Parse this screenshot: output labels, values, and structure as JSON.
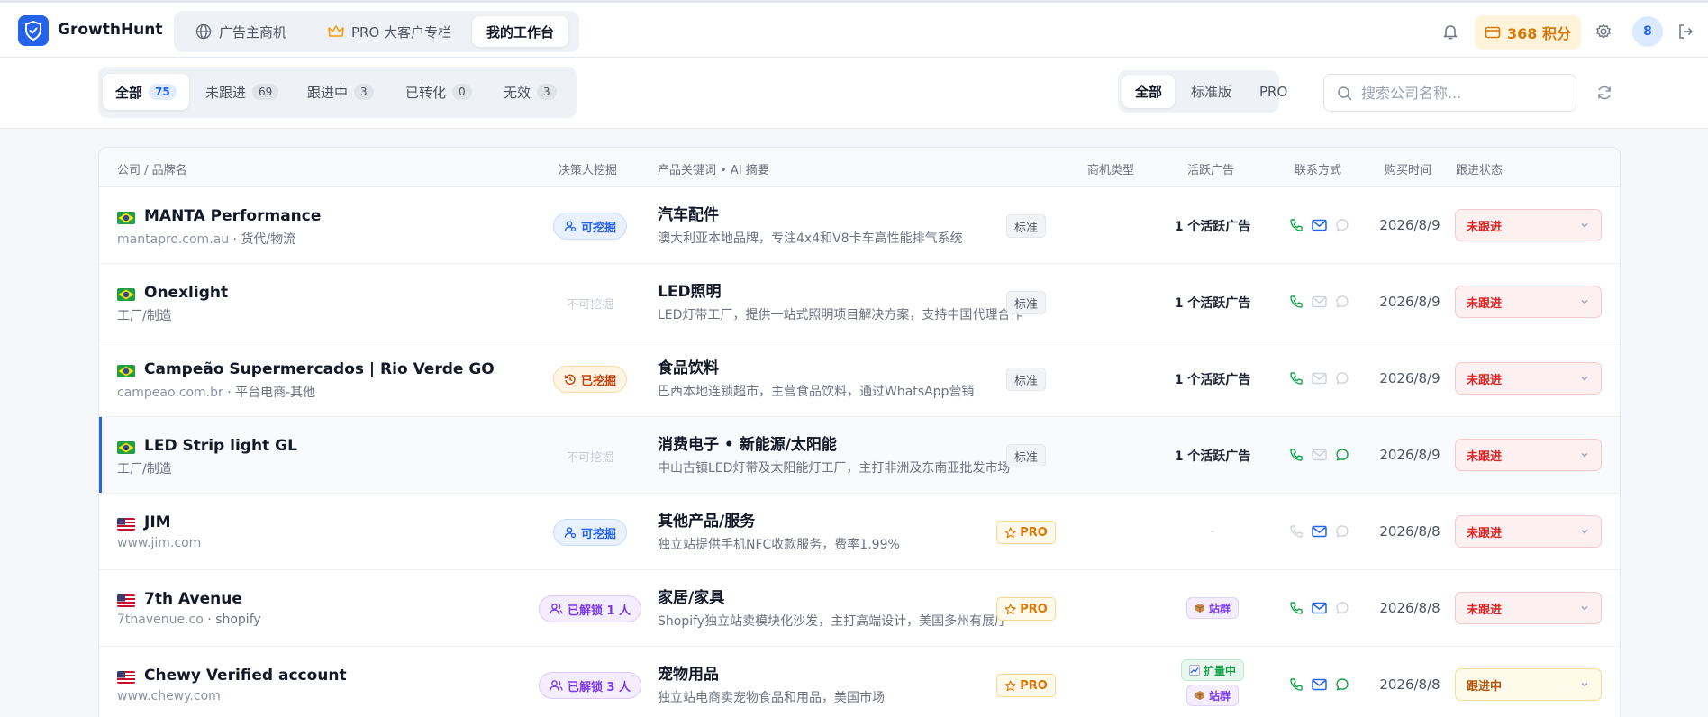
{
  "app": {
    "name": "GrowthHunt",
    "nav": [
      {
        "label": "广告主商机",
        "icon": "globe-icon"
      },
      {
        "label": "PRO 大客户专栏",
        "icon": "crown-icon"
      },
      {
        "label": "我的工作台",
        "icon": ""
      }
    ],
    "active_nav": "我的工作台",
    "points": "368 积分",
    "avatar_initial": "8"
  },
  "filters": {
    "status_tabs": [
      {
        "label": "全部",
        "count": "75"
      },
      {
        "label": "未跟进",
        "count": "69"
      },
      {
        "label": "跟进中",
        "count": "3"
      },
      {
        "label": "已转化",
        "count": "0"
      },
      {
        "label": "无效",
        "count": "3"
      }
    ],
    "active_status": "全部",
    "plan_tabs": [
      "全部",
      "标准版",
      "PRO"
    ],
    "active_plan": "全部",
    "search_placeholder": "搜索公司名称..."
  },
  "table": {
    "headers": {
      "company": "公司 / 品牌名",
      "decision_maker": "决策人挖掘",
      "product": "产品关键词 • AI 摘要",
      "type": "商机类型",
      "ads": "活跃广告",
      "contact": "联系方式",
      "purchase_time": "购买时间",
      "follow": "跟进状态"
    },
    "rows": [
      {
        "flag": "brazil",
        "name": "MANTA Performance",
        "domain": "mantapro.com.au",
        "category": "货代/物流",
        "decision": {
          "kind": "can",
          "label": "可挖掘"
        },
        "keyword": "汽车配件",
        "summary": "澳大利亚本地品牌，专注4x4和V8卡车高性能排气系统",
        "type": {
          "kind": "std",
          "label": "标准"
        },
        "ads": "1 个活跃广告",
        "tags": [],
        "contacts": {
          "phone": true,
          "mail": true,
          "chat": false
        },
        "time": "2026/8/9",
        "follow": {
          "kind": "todo",
          "label": "未跟进"
        },
        "selected": false
      },
      {
        "flag": "brazil",
        "name": "Onexlight",
        "domain": "",
        "category": "工厂/制造",
        "decision": {
          "kind": "no",
          "label": "不可挖掘"
        },
        "keyword": "LED照明",
        "summary": "LED灯带工厂，提供一站式照明项目解决方案，支持中国代理合作",
        "type": {
          "kind": "std",
          "label": "标准"
        },
        "ads": "1 个活跃广告",
        "tags": [],
        "contacts": {
          "phone": true,
          "mail": false,
          "chat": false
        },
        "time": "2026/8/9",
        "follow": {
          "kind": "todo",
          "label": "未跟进"
        },
        "selected": false
      },
      {
        "flag": "brazil",
        "name": "Campeão Supermercados | Rio Verde GO",
        "domain": "campeao.com.br",
        "category": "平台电商-其他",
        "decision": {
          "kind": "done",
          "label": "已挖掘"
        },
        "keyword": "食品饮料",
        "summary": "巴西本地连锁超市，主营食品饮料，通过WhatsApp营销",
        "type": {
          "kind": "std",
          "label": "标准"
        },
        "ads": "1 个活跃广告",
        "tags": [],
        "contacts": {
          "phone": true,
          "mail": false,
          "chat": false
        },
        "time": "2026/8/9",
        "follow": {
          "kind": "todo",
          "label": "未跟进"
        },
        "selected": false
      },
      {
        "flag": "brazil",
        "name": "LED Strip light GL",
        "domain": "",
        "category": "工厂/制造",
        "decision": {
          "kind": "no",
          "label": "不可挖掘"
        },
        "keyword": "消费电子 • 新能源/太阳能",
        "summary": "中山古镇LED灯带及太阳能灯工厂，主打非洲及东南亚批发市场",
        "type": {
          "kind": "std",
          "label": "标准"
        },
        "ads": "1 个活跃广告",
        "tags": [],
        "contacts": {
          "phone": true,
          "mail": false,
          "chat": true
        },
        "time": "2026/8/9",
        "follow": {
          "kind": "todo",
          "label": "未跟进"
        },
        "selected": true
      },
      {
        "flag": "usa",
        "name": "JIM",
        "domain": "www.jim.com",
        "category": "",
        "decision": {
          "kind": "can",
          "label": "可挖掘"
        },
        "keyword": "其他产品/服务",
        "summary": "独立站提供手机NFC收款服务，费率1.99%",
        "type": {
          "kind": "pro",
          "label": "PRO"
        },
        "ads": "-",
        "tags": [],
        "contacts": {
          "phone": false,
          "mail": true,
          "chat": false
        },
        "time": "2026/8/8",
        "follow": {
          "kind": "todo",
          "label": "未跟进"
        },
        "selected": false
      },
      {
        "flag": "usa",
        "name": "7th Avenue",
        "domain": "7thavenue.co",
        "category": "shopify",
        "decision": {
          "kind": "unlock",
          "label": "已解锁 1 人"
        },
        "keyword": "家居/家具",
        "summary": "Shopify独立站卖模块化沙发，主打高端设计，美国多州有展厅",
        "type": {
          "kind": "pro",
          "label": "PRO"
        },
        "ads": "",
        "tags": [
          {
            "kind": "group",
            "label": "站群",
            "icon": "box-icon"
          }
        ],
        "contacts": {
          "phone": true,
          "mail": true,
          "chat": false
        },
        "time": "2026/8/8",
        "follow": {
          "kind": "todo",
          "label": "未跟进"
        },
        "selected": false
      },
      {
        "flag": "usa",
        "name": "Chewy Verified account",
        "domain": "www.chewy.com",
        "category": "",
        "decision": {
          "kind": "unlock",
          "label": "已解锁 3 人"
        },
        "keyword": "宠物用品",
        "summary": "独立站电商卖宠物食品和用品，美国市场",
        "type": {
          "kind": "pro",
          "label": "PRO"
        },
        "ads": "",
        "tags": [
          {
            "kind": "expand",
            "label": "扩量中",
            "icon": "chart-icon"
          },
          {
            "kind": "group",
            "label": "站群",
            "icon": "box-icon"
          }
        ],
        "contacts": {
          "phone": true,
          "mail": true,
          "chat": true
        },
        "time": "2026/8/8",
        "follow": {
          "kind": "ing",
          "label": "跟进中"
        },
        "selected": false
      }
    ]
  },
  "colors": {
    "accent": "#2563eb",
    "phone_green": "#16a34a",
    "mail_blue": "#2563eb",
    "chat_green": "#16a34a",
    "disabled_gray": "#cfd4dc"
  }
}
